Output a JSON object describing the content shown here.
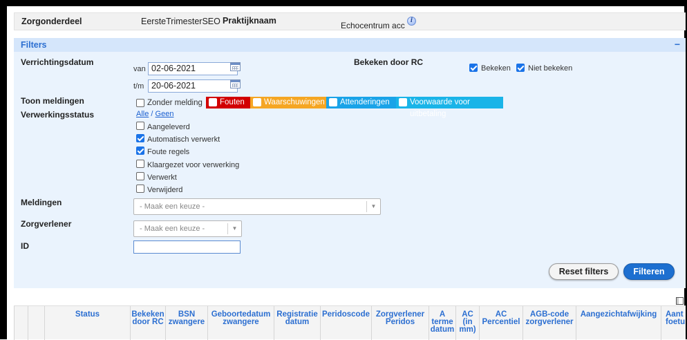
{
  "header": {
    "zorgonderdeel_label": "Zorgonderdeel",
    "zorgonderdeel_value": "EersteTrimesterSEO",
    "praktijknaam_label": "Praktijknaam",
    "praktijknaam_value": "Echocentrum acc"
  },
  "filters": {
    "title": "Filters",
    "collapse_symbol": "−",
    "verrichtingsdatum": {
      "label": "Verrichtingsdatum",
      "van_label": "van",
      "van_value": "02-06-2021",
      "tm_label": "t/m",
      "tm_value": "20-06-2021"
    },
    "bekeken_door_rc": {
      "label": "Bekeken door RC",
      "options": [
        {
          "label": "Bekeken",
          "checked": true
        },
        {
          "label": "Niet bekeken",
          "checked": true
        }
      ]
    },
    "toon_meldingen": {
      "label": "Toon meldingen",
      "zonder_melding": "Zonder melding",
      "fouten": "Fouten",
      "waarschuwingen": "Waarschuwingen",
      "attenderingen": "Attenderingen",
      "voorwaarde": "Voorwaarde voor uitbetaling",
      "colors": {
        "fouten": "#d20000",
        "waarschuwingen": "#f5a623",
        "attenderingen": "#1aa3e8",
        "voorwaarde": "#1ab4e8"
      }
    },
    "verwerkingsstatus": {
      "label": "Verwerkingsstatus",
      "alle": "Alle",
      "separator": "/",
      "geen": "Geen",
      "options": [
        {
          "label": "Aangeleverd",
          "checked": false
        },
        {
          "label": "Automatisch verwerkt",
          "checked": true
        },
        {
          "label": "Foute regels",
          "checked": true
        },
        {
          "label": "Klaargezet voor verwerking",
          "checked": false
        },
        {
          "label": "Verwerkt",
          "checked": false
        },
        {
          "label": "Verwijderd",
          "checked": false
        }
      ]
    },
    "meldingen": {
      "label": "Meldingen",
      "placeholder": "- Maak een keuze -"
    },
    "zorgverlener": {
      "label": "Zorgverlener",
      "placeholder": "- Maak een keuze -"
    },
    "id": {
      "label": "ID",
      "value": ""
    },
    "reset_label": "Reset filters",
    "filter_label": "Filteren"
  },
  "table": {
    "columns": [
      {
        "l1": "Status",
        "l2": "",
        "l3": ""
      },
      {
        "l1": "Bekeken",
        "l2": "door RC",
        "l3": ""
      },
      {
        "l1": "BSN",
        "l2": "zwangere",
        "l3": ""
      },
      {
        "l1": "Geboortedatum",
        "l2": "zwangere",
        "l3": ""
      },
      {
        "l1": "Registratie",
        "l2": "datum",
        "l3": ""
      },
      {
        "l1": "Peridoscode",
        "l2": "",
        "l3": ""
      },
      {
        "l1": "Zorgverlener",
        "l2": "Peridos",
        "l3": ""
      },
      {
        "l1": "A",
        "l2": "terme",
        "l3": "datum"
      },
      {
        "l1": "AC",
        "l2": "(in",
        "l3": "mm)"
      },
      {
        "l1": "AC",
        "l2": "Percentiel",
        "l3": ""
      },
      {
        "l1": "AGB-code",
        "l2": "zorgverlener",
        "l3": ""
      },
      {
        "l1": "Aangezichtafwijking",
        "l2": "",
        "l3": ""
      },
      {
        "l1": "Aant",
        "l2": "foetu",
        "l3": ""
      }
    ]
  }
}
